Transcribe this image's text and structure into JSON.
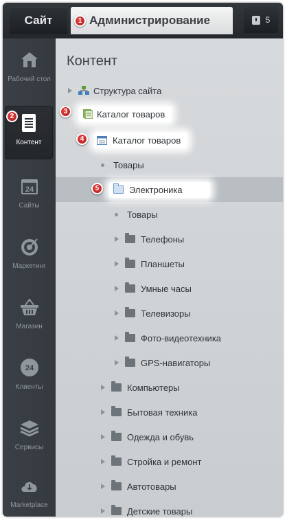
{
  "header": {
    "site_tab": "Сайт",
    "admin_tab": "Администрирование",
    "notifications_count": "5"
  },
  "sidebar": {
    "items": [
      {
        "label": "Рабочий стол",
        "icon": "home-icon"
      },
      {
        "label": "Контент",
        "icon": "document-icon",
        "active": true
      },
      {
        "label": "Сайты",
        "icon": "calendar-24-icon"
      },
      {
        "label": "Маркетинг",
        "icon": "target-icon"
      },
      {
        "label": "Магазин",
        "icon": "basket-icon"
      },
      {
        "label": "Клиенты",
        "icon": "clients-24-icon"
      },
      {
        "label": "Сервисы",
        "icon": "layers-icon"
      },
      {
        "label": "Marketplace",
        "icon": "cloud-download-icon"
      }
    ]
  },
  "main": {
    "title": "Контент",
    "tree": [
      {
        "label": "Структура сайта",
        "icon": "sitemap-icon"
      },
      {
        "label": "Каталог товаров",
        "icon": "catalog-icon"
      },
      {
        "label": "Каталог товаров",
        "icon": "window-icon"
      },
      {
        "label": "Товары"
      },
      {
        "label": "Электроника",
        "icon": "folder-icon"
      },
      {
        "label": "Товары"
      },
      {
        "label": "Телефоны",
        "icon": "folder-icon"
      },
      {
        "label": "Планшеты",
        "icon": "folder-icon"
      },
      {
        "label": "Умные часы",
        "icon": "folder-icon"
      },
      {
        "label": "Телевизоры",
        "icon": "folder-icon"
      },
      {
        "label": "Фото-видеотехника",
        "icon": "folder-icon"
      },
      {
        "label": "GPS-навигаторы",
        "icon": "folder-icon"
      },
      {
        "label": "Компьютеры",
        "icon": "folder-icon"
      },
      {
        "label": "Бытовая техника",
        "icon": "folder-icon"
      },
      {
        "label": "Одежда и обувь",
        "icon": "folder-icon"
      },
      {
        "label": "Стройка и ремонт",
        "icon": "folder-icon"
      },
      {
        "label": "Автотовары",
        "icon": "folder-icon"
      },
      {
        "label": "Детские товары",
        "icon": "folder-icon"
      }
    ]
  },
  "markers": [
    "1",
    "2",
    "3",
    "4",
    "5"
  ],
  "colors": {
    "header_bg": "#2a2e32",
    "sidebar_bg": "#383d43",
    "content_bg": "#d2d5d8",
    "marker_red": "#c62828"
  }
}
